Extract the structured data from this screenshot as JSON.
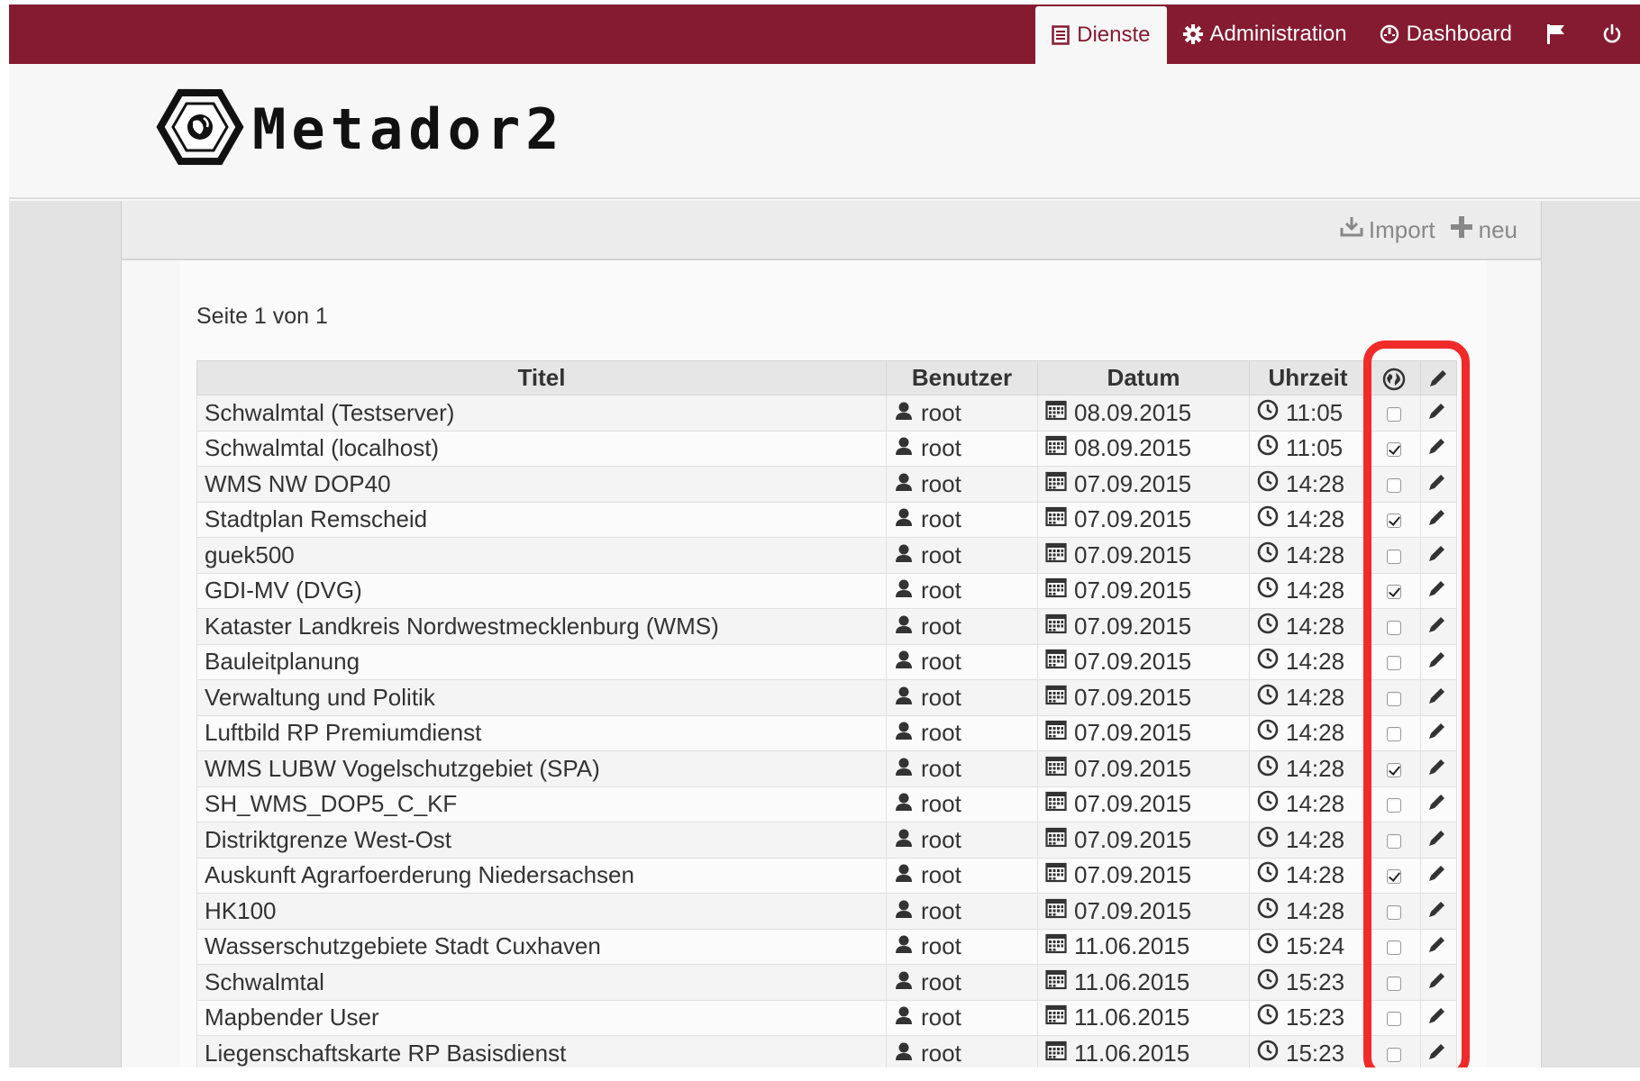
{
  "topnav": {
    "items": [
      {
        "label": "Dienste",
        "icon": "list-icon",
        "active": true
      },
      {
        "label": "Administration",
        "icon": "gear-icon",
        "active": false
      },
      {
        "label": "Dashboard",
        "icon": "dashboard-icon",
        "active": false
      }
    ],
    "flag_icon": "flag-icon",
    "power_icon": "power-icon"
  },
  "logo": {
    "text": "Metador2",
    "icon": "metador-logo-icon"
  },
  "toolbar": {
    "import_label": "Import",
    "new_label": "neu"
  },
  "page_info": "Seite 1 von 1",
  "table": {
    "headers": {
      "title": "Titel",
      "user": "Benutzer",
      "date": "Datum",
      "time": "Uhrzeit",
      "public_icon": "globe-icon",
      "edit_icon": "pencil-icon"
    },
    "rows": [
      {
        "title": "Schwalmtal (Testserver)",
        "user": "root",
        "date": "08.09.2015",
        "time": "11:05",
        "checked": false
      },
      {
        "title": "Schwalmtal (localhost)",
        "user": "root",
        "date": "08.09.2015",
        "time": "11:05",
        "checked": true
      },
      {
        "title": "WMS NW DOP40",
        "user": "root",
        "date": "07.09.2015",
        "time": "14:28",
        "checked": false
      },
      {
        "title": "Stadtplan Remscheid",
        "user": "root",
        "date": "07.09.2015",
        "time": "14:28",
        "checked": true
      },
      {
        "title": "guek500",
        "user": "root",
        "date": "07.09.2015",
        "time": "14:28",
        "checked": false
      },
      {
        "title": "GDI-MV (DVG)",
        "user": "root",
        "date": "07.09.2015",
        "time": "14:28",
        "checked": true
      },
      {
        "title": "Kataster Landkreis Nordwestmecklenburg (WMS)",
        "user": "root",
        "date": "07.09.2015",
        "time": "14:28",
        "checked": false
      },
      {
        "title": "Bauleitplanung",
        "user": "root",
        "date": "07.09.2015",
        "time": "14:28",
        "checked": false
      },
      {
        "title": "Verwaltung und Politik",
        "user": "root",
        "date": "07.09.2015",
        "time": "14:28",
        "checked": false
      },
      {
        "title": "Luftbild RP Premiumdienst",
        "user": "root",
        "date": "07.09.2015",
        "time": "14:28",
        "checked": false
      },
      {
        "title": "WMS LUBW Vogelschutzgebiet (SPA)",
        "user": "root",
        "date": "07.09.2015",
        "time": "14:28",
        "checked": true
      },
      {
        "title": "SH_WMS_DOP5_C_KF",
        "user": "root",
        "date": "07.09.2015",
        "time": "14:28",
        "checked": false
      },
      {
        "title": "Distriktgrenze West-Ost",
        "user": "root",
        "date": "07.09.2015",
        "time": "14:28",
        "checked": false
      },
      {
        "title": "Auskunft Agrarfoerderung Niedersachsen",
        "user": "root",
        "date": "07.09.2015",
        "time": "14:28",
        "checked": true
      },
      {
        "title": "HK100",
        "user": "root",
        "date": "07.09.2015",
        "time": "14:28",
        "checked": false
      },
      {
        "title": "Wasserschutzgebiete Stadt Cuxhaven",
        "user": "root",
        "date": "11.06.2015",
        "time": "15:24",
        "checked": false
      },
      {
        "title": "Schwalmtal",
        "user": "root",
        "date": "11.06.2015",
        "time": "15:23",
        "checked": false
      },
      {
        "title": "Mapbender User",
        "user": "root",
        "date": "11.06.2015",
        "time": "15:23",
        "checked": false
      },
      {
        "title": "Liegenschaftskarte RP Basisdienst",
        "user": "root",
        "date": "11.06.2015",
        "time": "15:23",
        "checked": false
      }
    ]
  },
  "colors": {
    "topbar": "#851b31",
    "highlight": "#f12a2a",
    "panel": "#e3e3e3"
  }
}
